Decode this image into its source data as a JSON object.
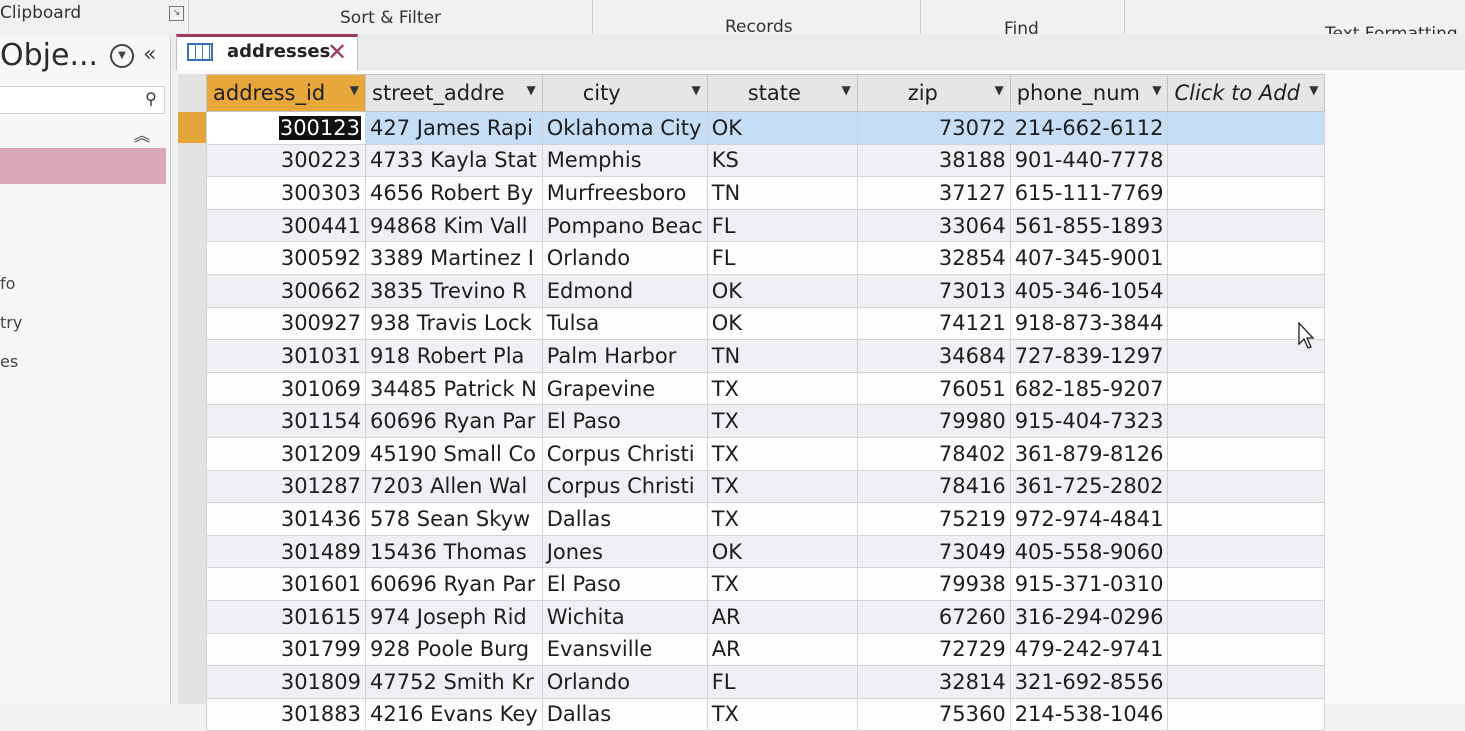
{
  "ribbon": {
    "groups": [
      "Clipboard",
      "Sort & Filter",
      "Records",
      "Find",
      "Text Formatting"
    ]
  },
  "nav": {
    "title": "Obje...",
    "menu_icon": "circle-chevron-down-icon",
    "collapse_label": "«",
    "up_label": "⌃",
    "items": [
      "fo",
      "try",
      "es"
    ]
  },
  "tab": {
    "label": "addresses",
    "close_label": "✕"
  },
  "table": {
    "columns": [
      "address_id",
      "street_addre",
      "city",
      "state",
      "zip",
      "phone_num",
      "Click to Add"
    ],
    "rows": [
      [
        "300123",
        "427 James Rapi",
        "Oklahoma City",
        "OK",
        "73072",
        "214-662-6112"
      ],
      [
        "300223",
        "4733 Kayla Stat",
        "Memphis",
        "KS",
        "38188",
        "901-440-7778"
      ],
      [
        "300303",
        "4656 Robert By",
        "Murfreesboro",
        "TN",
        "37127",
        "615-111-7769"
      ],
      [
        "300441",
        "94868 Kim Vall",
        "Pompano Beac",
        "FL",
        "33064",
        "561-855-1893"
      ],
      [
        "300592",
        "3389 Martinez I",
        "Orlando",
        "FL",
        "32854",
        "407-345-9001"
      ],
      [
        "300662",
        "3835 Trevino R",
        "Edmond",
        "OK",
        "73013",
        "405-346-1054"
      ],
      [
        "300927",
        "938 Travis Lock",
        "Tulsa",
        "OK",
        "74121",
        "918-873-3844"
      ],
      [
        "301031",
        "918 Robert Pla",
        "Palm Harbor",
        "TN",
        "34684",
        "727-839-1297"
      ],
      [
        "301069",
        "34485 Patrick N",
        "Grapevine",
        "TX",
        "76051",
        "682-185-9207"
      ],
      [
        "301154",
        "60696 Ryan Par",
        "El Paso",
        "TX",
        "79980",
        "915-404-7323"
      ],
      [
        "301209",
        "45190 Small Co",
        "Corpus Christi",
        "TX",
        "78402",
        "361-879-8126"
      ],
      [
        "301287",
        "7203 Allen Wal",
        "Corpus Christi",
        "TX",
        "78416",
        "361-725-2802"
      ],
      [
        "301436",
        "578 Sean Skyw",
        "Dallas",
        "TX",
        "75219",
        "972-974-4841"
      ],
      [
        "301489",
        "15436 Thomas",
        "Jones",
        "OK",
        "73049",
        "405-558-9060"
      ],
      [
        "301601",
        "60696 Ryan Par",
        "El Paso",
        "TX",
        "79938",
        "915-371-0310"
      ],
      [
        "301615",
        "974 Joseph Rid",
        "Wichita",
        "AR",
        "67260",
        "316-294-0296"
      ],
      [
        "301799",
        "928 Poole Burg",
        "Evansville",
        "AR",
        "72729",
        "479-242-9741"
      ],
      [
        "301809",
        "47752 Smith Kr",
        "Orlando",
        "FL",
        "32814",
        "321-692-8556"
      ],
      [
        "301883",
        "4216 Evans Key",
        "Dallas",
        "TX",
        "75360",
        "214-538-1046"
      ]
    ]
  },
  "colors": {
    "accent": "#a33b58",
    "header_highlight": "#e8a73a",
    "selected_row": "#c5ddf5",
    "nav_selected": "#d9a8bb"
  }
}
